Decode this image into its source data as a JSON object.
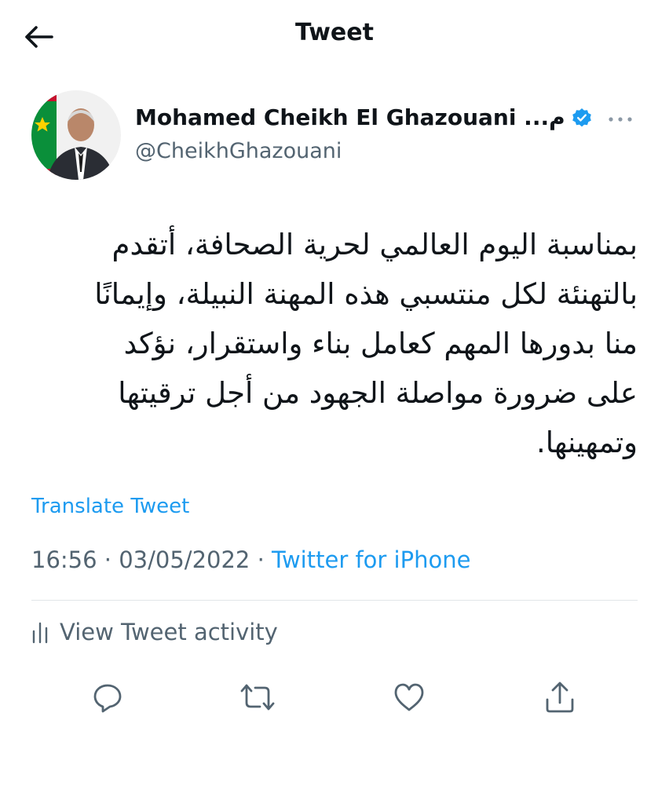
{
  "header": {
    "title": "Tweet",
    "back_icon": "arrow-left-icon"
  },
  "author": {
    "display_name": "Mohamed Cheikh El Ghazouani ...م",
    "handle": "@CheikhGhazouani",
    "verified_icon": "verified-badge-icon",
    "more_icon": "more-horizontal-icon"
  },
  "tweet": {
    "text": "بمناسبة اليوم العالمي لحرية الصحافة، أتقدم\nبالتهنئة لكل منتسبي هذه المهنة النبيلة، وإيمانًا\nمنا  بدورها المهم كعامل بناء واستقرار، نؤكد\nعلى ضرورة مواصلة الجهود من أجل ترقيتها\nوتمهينها.",
    "translate_label": "Translate Tweet",
    "time": "16:56",
    "separator": "·",
    "date": "03/05/2022",
    "source": "Twitter for iPhone"
  },
  "activity": {
    "label": "View Tweet activity",
    "icon": "bar-chart-icon"
  },
  "actions": [
    {
      "name": "reply",
      "icon": "reply-icon"
    },
    {
      "name": "retweet",
      "icon": "retweet-icon"
    },
    {
      "name": "like",
      "icon": "heart-icon"
    },
    {
      "name": "share",
      "icon": "share-icon"
    }
  ],
  "colors": {
    "accent": "#1d9bf0",
    "text": "#0f1419",
    "secondary": "#536471",
    "divider": "#e1e5e8"
  }
}
